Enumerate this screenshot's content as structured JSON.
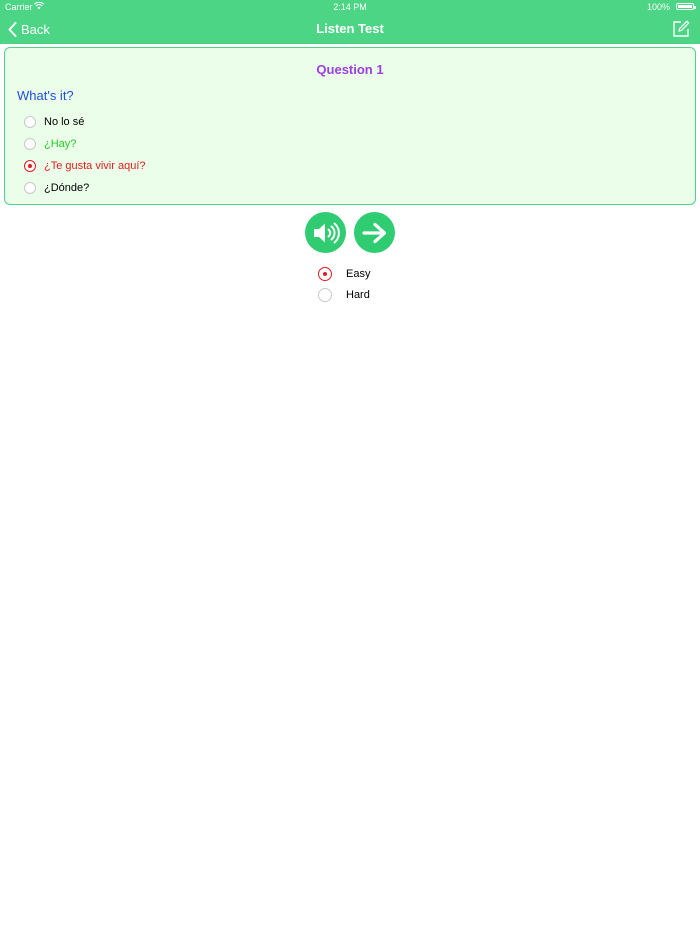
{
  "status_bar": {
    "carrier": "Carrier",
    "time": "2:14 PM",
    "battery": "100%"
  },
  "nav": {
    "back_label": "Back",
    "title": "Listen Test"
  },
  "question": {
    "title": "Question 1",
    "prompt": "What's it?",
    "options": [
      {
        "label": "No lo sé",
        "selected": false,
        "color": "#000000"
      },
      {
        "label": "¿Hay?",
        "selected": false,
        "color": "#22cc22"
      },
      {
        "label": "¿Te gusta vivir aquí?",
        "selected": true,
        "color": "#e11d1d"
      },
      {
        "label": "¿Dónde?",
        "selected": false,
        "color": "#000000"
      }
    ]
  },
  "controls": {
    "speaker_icon": "speaker-icon",
    "next_icon": "arrow-right-icon"
  },
  "difficulty": {
    "options": [
      {
        "label": "Easy",
        "selected": true
      },
      {
        "label": "Hard",
        "selected": false
      }
    ]
  },
  "colors": {
    "accent": "#4cd584",
    "card_bg": "#eafeea",
    "button": "#2fcc72",
    "question_title": "#9b3fe0",
    "prompt": "#1f4fe0",
    "selected": "#e11d1d"
  }
}
